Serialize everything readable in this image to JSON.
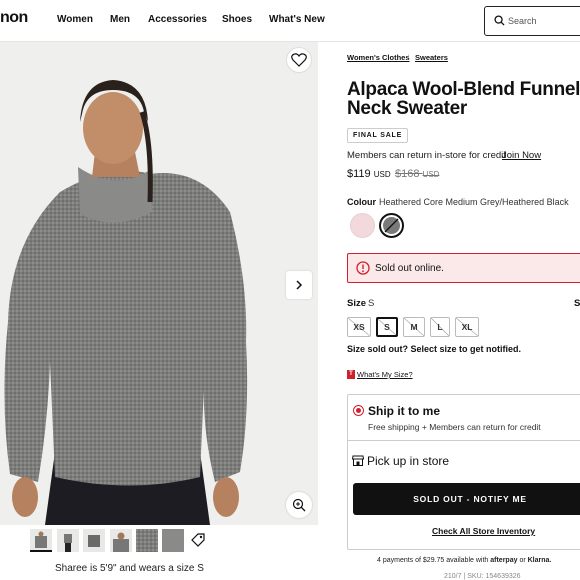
{
  "header": {
    "logo_text": "non",
    "nav": [
      "Women",
      "Men",
      "Accessories",
      "Shoes",
      "What's New"
    ],
    "search_placeholder": "Search"
  },
  "gallery": {
    "model_caption": "Sharee is 5'9\" and wears a size S",
    "thumbnail_count": 6
  },
  "breadcrumb": [
    "Women's Clothes",
    "Sweaters"
  ],
  "product": {
    "title_line1": "Alpaca Wool-Blend Funnel-",
    "title_line2": "Neck Sweater",
    "badge": "FINAL SALE",
    "members_text": "Members can return in-store for credit",
    "join_link": "Join Now",
    "price": "$119",
    "price_currency": "USD",
    "original_price": "$168",
    "original_currency": "USD",
    "colour_label": "Colour",
    "colour_name": "Heathered Core Medium Grey/Heathered Black",
    "swatches": [
      {
        "name": "pink-heather",
        "color": "#f1d9dc",
        "selected": false
      },
      {
        "name": "grey-heather",
        "color": "#7a7a7a",
        "selected": true
      }
    ],
    "sold_out_message": "Sold out online.",
    "size_label": "Size",
    "size_value": "S",
    "size_guide_cut": "S",
    "sizes": [
      {
        "label": "XS",
        "selected": false
      },
      {
        "label": "S",
        "selected": true
      },
      {
        "label": "M",
        "selected": false
      },
      {
        "label": "L",
        "selected": false
      },
      {
        "label": "XL",
        "selected": false
      }
    ],
    "size_note": "Size sold out? Select size to get notified.",
    "whats_my_size": "What's My Size?",
    "whats_my_size_badge": "T"
  },
  "fulfillment": {
    "ship_title": "Ship it to me",
    "ship_sub": "Free shipping + Members can return for credit",
    "pickup_title": "Pick up in store",
    "notify_button": "SOLD OUT - NOTIFY ME",
    "check_inventory": "Check All Store Inventory"
  },
  "payments": {
    "text": "4 payments of $29.75 available with",
    "afterpay": "afterpay",
    "or": "or",
    "klarna": "Klarna."
  },
  "sku_cut": "210/7 | SKU: 154639326",
  "colors": {
    "brand_red": "#d11f2d",
    "sold_out_bg": "#fbe9ea",
    "button_black": "#111111"
  }
}
